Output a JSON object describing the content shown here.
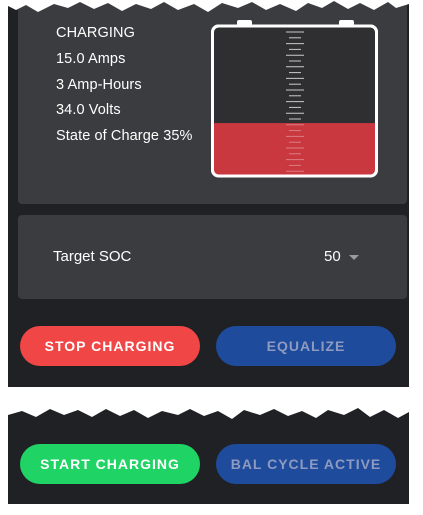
{
  "status": {
    "state": "CHARGING",
    "current": "15.0 Amps",
    "capacity": "3 Amp-Hours",
    "voltage": "34.0 Volts",
    "soc_text": "State of Charge 35%",
    "soc_fraction": 0.35
  },
  "target": {
    "label": "Target SOC",
    "value": "50",
    "icon": "chevron-down-icon"
  },
  "actions": {
    "stop_label": "STOP CHARGING",
    "equalize_label": "EQUALIZE",
    "start_label": "START CHARGING",
    "balance_label": "BAL CYCLE ACTIVE"
  },
  "colors": {
    "background": "#202124",
    "card": "#3b3c3f",
    "battery_fill": "#c9383f",
    "stop": "#f04646",
    "start": "#1fd365",
    "disabled_blue": "#1f4b9c"
  }
}
